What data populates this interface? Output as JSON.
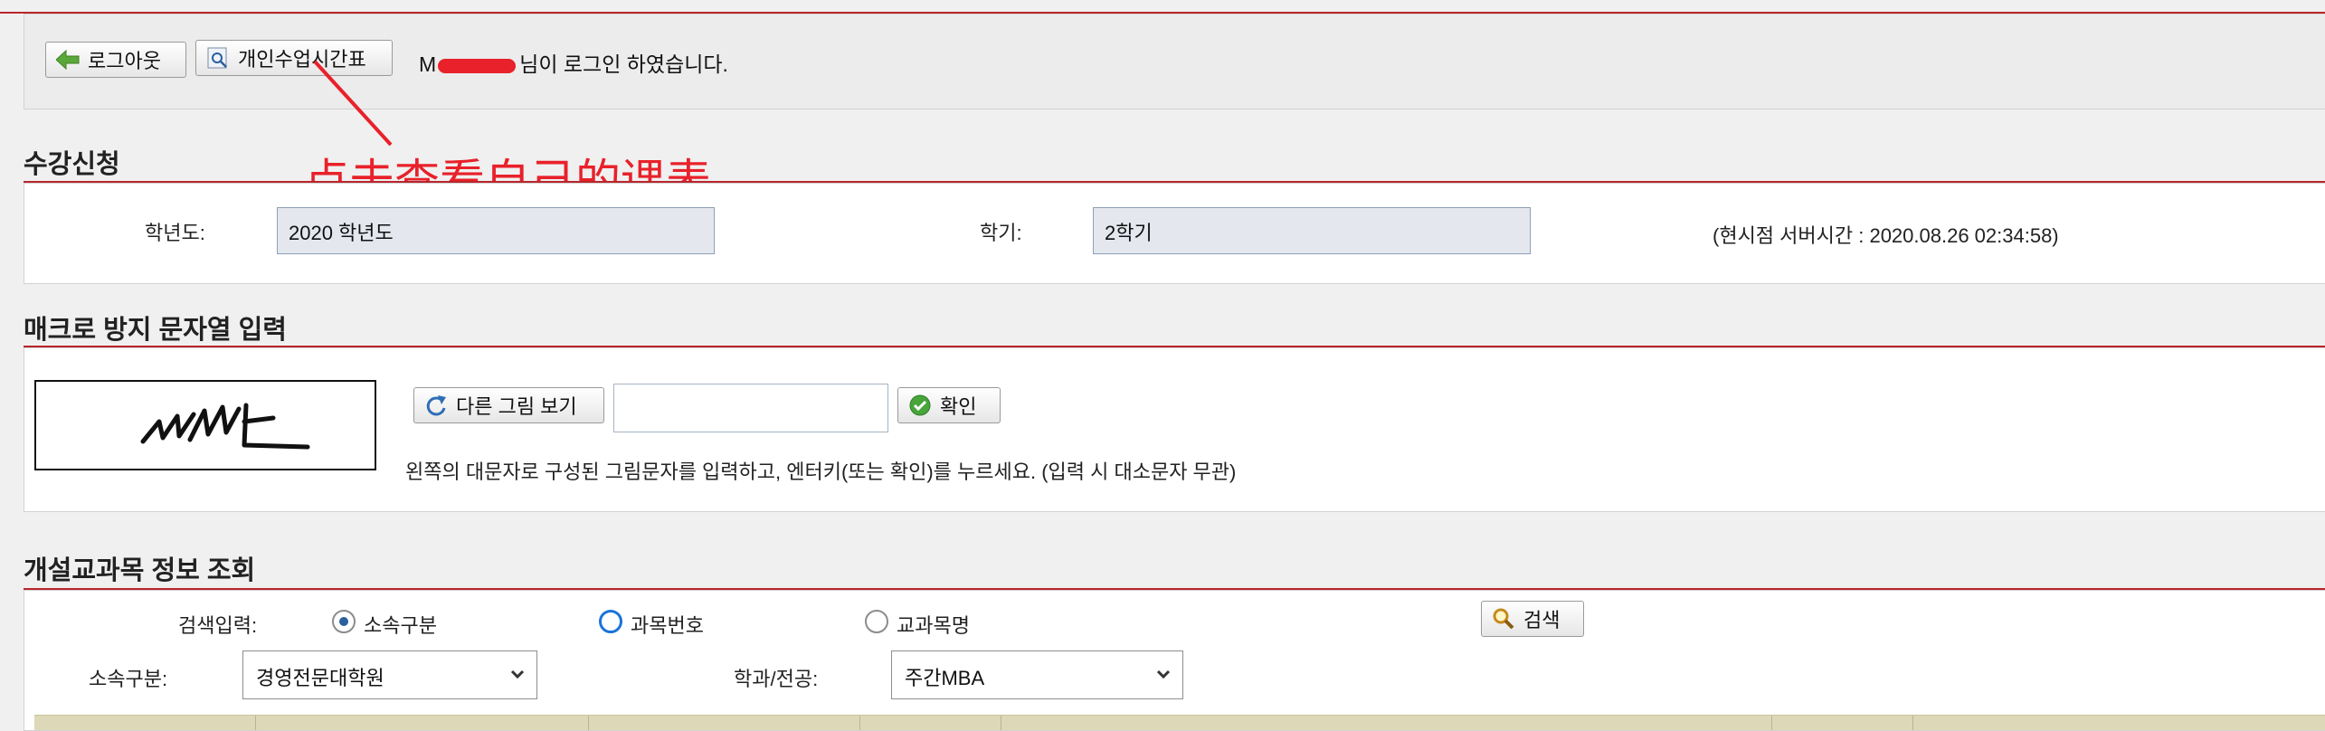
{
  "header": {
    "logout_label": "로그아웃",
    "timetable_label": "개인수업시간표",
    "login_prefix": "M",
    "login_message": "님이 로그인 하였습니다."
  },
  "annotation": {
    "text": "点击查看自己的课表",
    "color": "#e8212a"
  },
  "registration": {
    "title": "수강신청",
    "year_label": "학년도:",
    "year_value": "2020 학년도",
    "semester_label": "학기:",
    "semester_value": "2학기",
    "server_time_label": "(현시점 서버시간 :  2020.08.26  02:34:58)"
  },
  "captcha": {
    "title": "매크로 방지 문자열 입력",
    "image_text": "MWE",
    "refresh_label": "다른 그림 보기",
    "input_value": "",
    "confirm_label": "확인",
    "instruction": "왼쪽의 대문자로 구성된 그림문자를 입력하고, 엔터키(또는 확인)를 누르세요. (입력 시 대소문자 무관)"
  },
  "course_search": {
    "title": "개설교과목 정보 조회",
    "search_label": "검색입력:",
    "radio_options": [
      {
        "label": "소속구분",
        "checked": true
      },
      {
        "label": "과목번호",
        "checked": false
      },
      {
        "label": "교과목명",
        "checked": false
      }
    ],
    "search_button_label": "검색",
    "affiliation_label": "소속구분:",
    "affiliation_value": "경영전문대학원",
    "department_label": "학과/전공:",
    "department_value": "주간MBA"
  },
  "colors": {
    "accent_red": "#b8262c",
    "field_bg": "#e4e8ee",
    "table_header_bg": "#ddd9b8"
  }
}
